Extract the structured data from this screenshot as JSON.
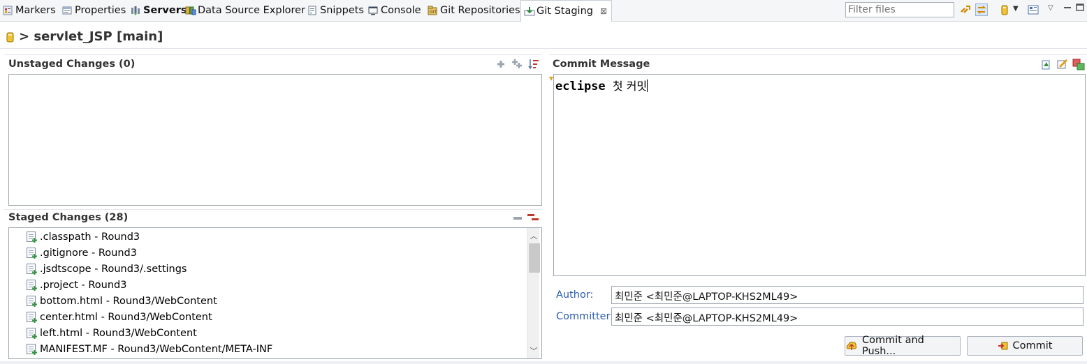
{
  "tabs": [
    {
      "label": "Markers",
      "icon": "markers-icon"
    },
    {
      "label": "Properties",
      "icon": "properties-icon"
    },
    {
      "label": "Servers",
      "icon": "servers-icon"
    },
    {
      "label": "Data Source Explorer",
      "icon": "data-source-icon"
    },
    {
      "label": "Snippets",
      "icon": "snippets-icon"
    },
    {
      "label": "Console",
      "icon": "console-icon"
    },
    {
      "label": "Git Repositories",
      "icon": "git-repositories-icon"
    },
    {
      "label": "Git Staging",
      "icon": "git-staging-icon",
      "active": true
    }
  ],
  "toolbar": {
    "filter_placeholder": "Filter files",
    "close_glyph": "⊠"
  },
  "repository": {
    "title": "> servlet_JSP [main]"
  },
  "unstaged": {
    "title": "Unstaged Changes (0)"
  },
  "staged": {
    "title": "Staged Changes (28)",
    "items": [
      ".classpath - Round3",
      ".gitignore - Round3",
      ".jsdtscope - Round3/.settings",
      ".project - Round3",
      "bottom.html - Round3/WebContent",
      "center.html - Round3/WebContent",
      "left.html - Round3/WebContent",
      "MANIFEST.MF - Round3/WebContent/META-INF"
    ]
  },
  "commit": {
    "title": "Commit Message",
    "message_code": "eclipse",
    "message_text": "첫 커밋",
    "author_label": "Author:",
    "author_value": "최민준 <최민준@LAPTOP-KHS2ML49>",
    "committer_label": "Committer:",
    "committer_value": "최민준 <최민준@LAPTOP-KHS2ML49>",
    "commit_push_label": "Commit and Push...",
    "commit_label": "Commit"
  },
  "colors": {
    "accent_blue": "#2a5db0",
    "tab_bg": "#f5f6f8",
    "border": "#9da5b1"
  }
}
